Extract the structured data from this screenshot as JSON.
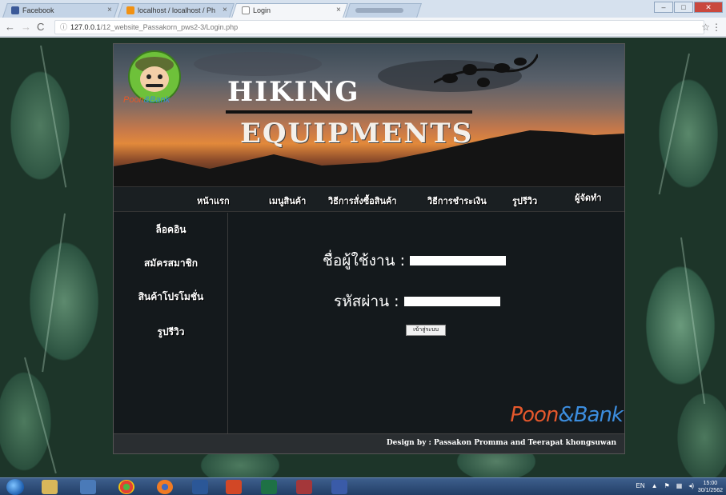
{
  "browser": {
    "tabs": [
      {
        "title": "Facebook",
        "active": false
      },
      {
        "title": "localhost / localhost / Ph",
        "active": false
      },
      {
        "title": "Login",
        "active": true
      },
      {
        "title": "",
        "active": false
      }
    ],
    "url_info_icon": "ⓘ",
    "url_host": "127.0.0.1",
    "url_path": "/12_website_Passakorn_pws2-3/Login.php"
  },
  "site": {
    "logo_text_a": "Poon",
    "logo_text_b": "&Bank",
    "title_line1": "HIKING",
    "title_line2": "EQUIPMENTS",
    "nav": [
      "หน้าแรก",
      "เมนูสินค้า",
      "วิธีการสั่งซื้อสินค้า",
      "วิธีการชำระเงิน",
      "รูปรีวิว",
      "ผู้จัดทำ"
    ],
    "sidebar": [
      "ล็อคอิน",
      "สมัครสมาชิก",
      "สินค้าโปรโมชั่น",
      "รูปรีวิว"
    ],
    "form": {
      "username_label": "ชื่อผู้ใช้งาน :",
      "password_label": "รหัสผ่าน :",
      "submit_label": "เข้าสู่ระบบ"
    },
    "brand_a": "Poon",
    "brand_b": "&Bank",
    "footer": "Design by : Passakon Promma and Teerapat  khongsuwan"
  },
  "taskbar": {
    "lang": "EN",
    "time": "15:00",
    "date": "30/1/2562"
  },
  "colors": {
    "accent_orange": "#e5582c",
    "accent_blue": "#3c8dde",
    "site_bg": "#14191c"
  }
}
